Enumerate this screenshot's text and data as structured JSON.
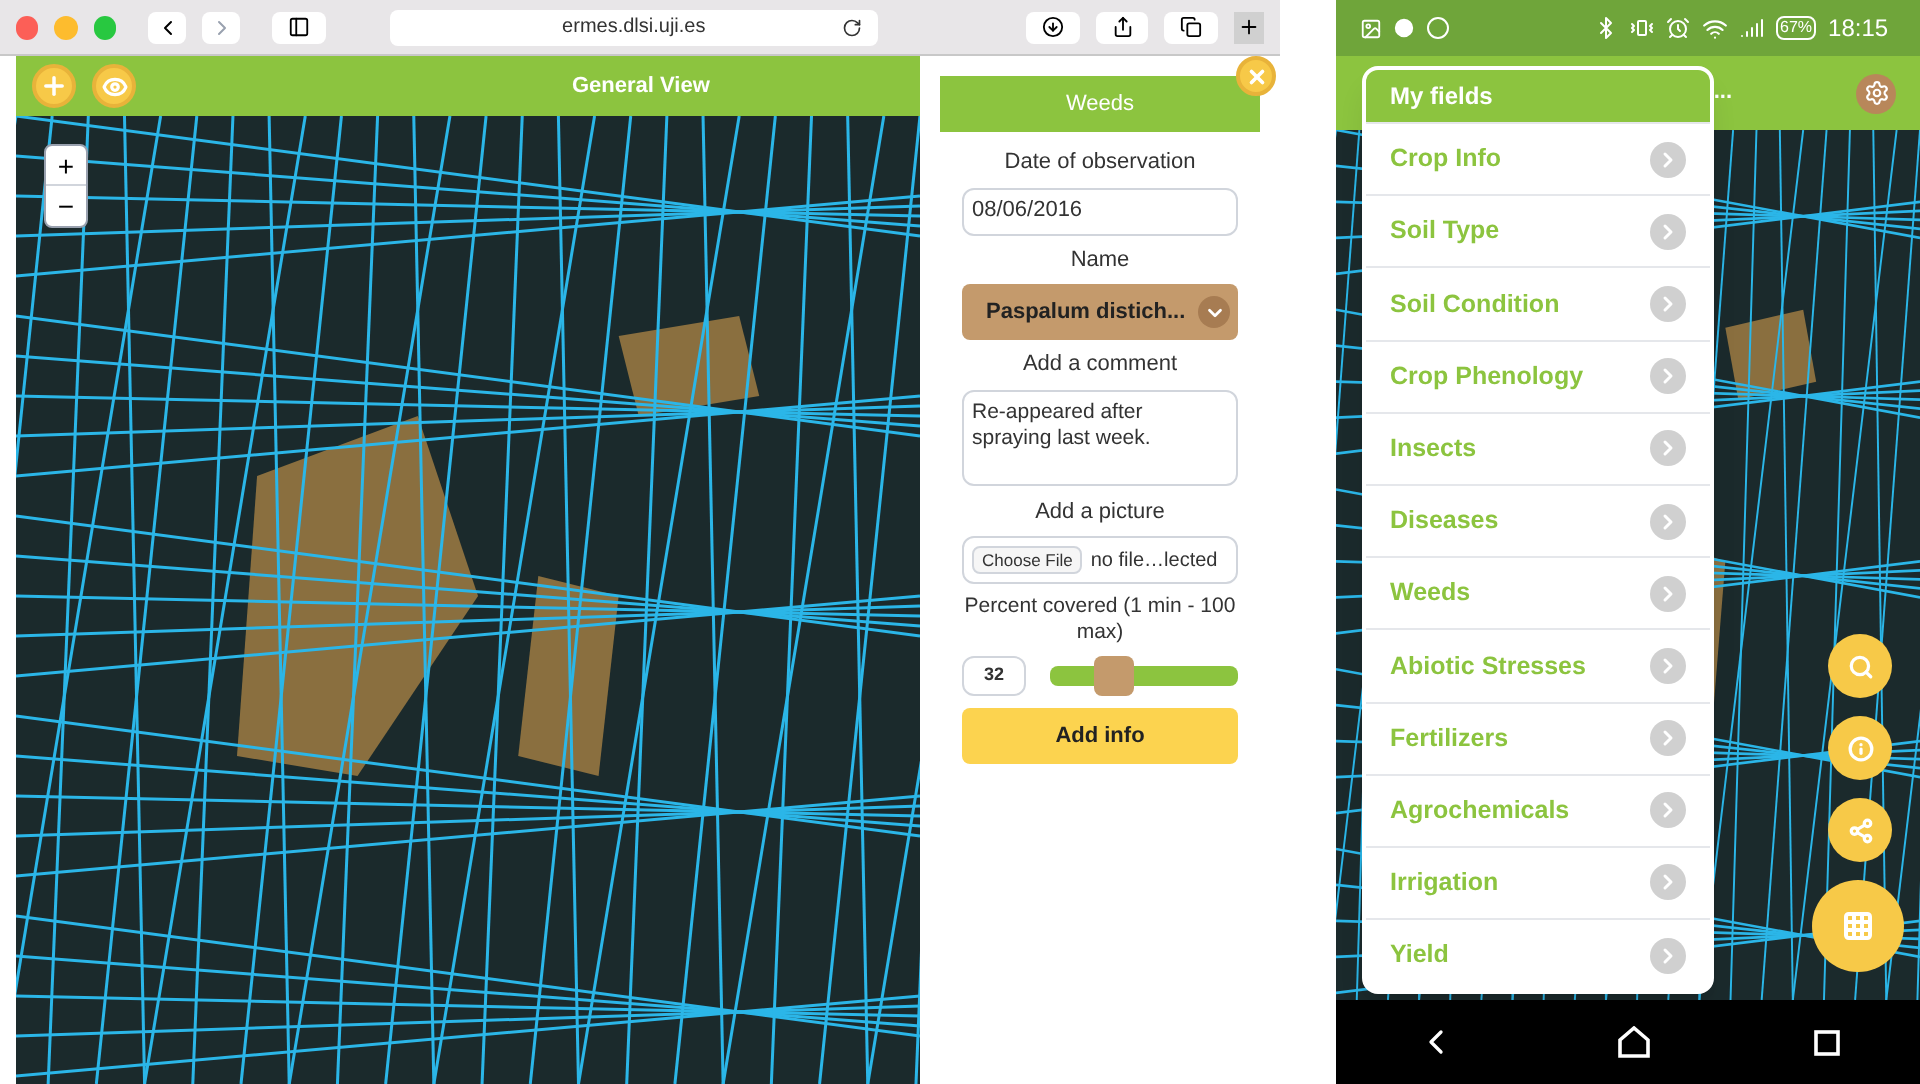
{
  "browser": {
    "url": "ermes.dlsi.uji.es"
  },
  "web_app": {
    "title": "General View",
    "zoom_in": "+",
    "zoom_out": "−",
    "panel": {
      "title": "Weeds",
      "date_label": "Date of observation",
      "date_value": "08/06/2016",
      "name_label": "Name",
      "name_value": "Paspalum distich...",
      "comment_label": "Add a comment",
      "comment_value": "Re-appeared after spraying last week.",
      "picture_label": "Add a picture",
      "file_button": "Choose File",
      "file_status": "no file…lected",
      "percent_label": "Percent covered (1 min - 100 max)",
      "percent_value": "32",
      "level": 0.3,
      "submit": "Add info"
    }
  },
  "phone": {
    "status_bar": {
      "battery": "67%",
      "time": "18:15"
    },
    "app_title": "...",
    "menu": {
      "title": "My fields",
      "items": [
        {
          "label": "Crop Info"
        },
        {
          "label": "Soil Type"
        },
        {
          "label": "Soil Condition"
        },
        {
          "label": "Crop Phenology"
        },
        {
          "label": "Insects"
        },
        {
          "label": "Diseases"
        },
        {
          "label": "Weeds"
        },
        {
          "label": "Abiotic Stresses"
        },
        {
          "label": "Fertilizers"
        },
        {
          "label": "Agrochemicals"
        },
        {
          "label": "Irrigation"
        },
        {
          "label": "Yield"
        }
      ]
    }
  }
}
